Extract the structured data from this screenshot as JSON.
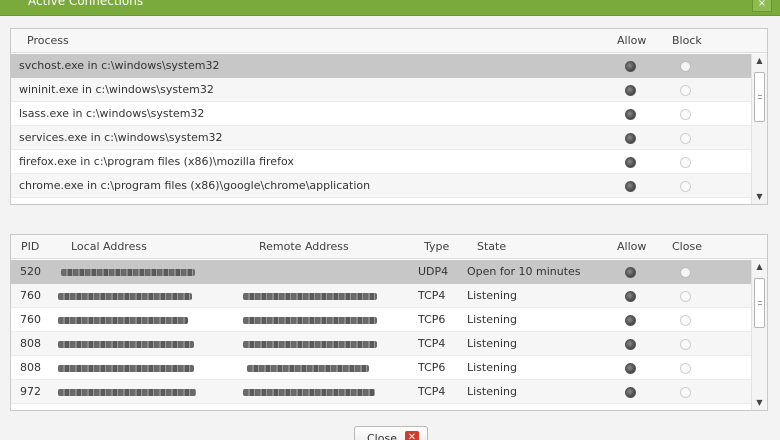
{
  "window": {
    "title": "Active Connections",
    "close_glyph": "×"
  },
  "process_table": {
    "columns": {
      "process": "Process",
      "allow": "Allow",
      "block": "Block"
    },
    "rows": [
      {
        "process": "svchost.exe in c:\\windows\\system32",
        "allow": true,
        "block": false
      },
      {
        "process": "wininit.exe in c:\\windows\\system32",
        "allow": true,
        "block": false
      },
      {
        "process": "lsass.exe in c:\\windows\\system32",
        "allow": true,
        "block": false
      },
      {
        "process": "services.exe in c:\\windows\\system32",
        "allow": true,
        "block": false
      },
      {
        "process": "firefox.exe in c:\\program files (x86)\\mozilla firefox",
        "allow": true,
        "block": false
      },
      {
        "process": "chrome.exe in c:\\program files (x86)\\google\\chrome\\application",
        "allow": true,
        "block": false
      }
    ],
    "selected_row": 0
  },
  "connection_table": {
    "columns": {
      "pid": "PID",
      "local": "Local Address",
      "remote": "Remote Address",
      "type": "Type",
      "state": "State",
      "allow": "Allow",
      "close": "Close"
    },
    "rows": [
      {
        "pid": "520",
        "type": "UDP4",
        "state": "Open for 10 minutes",
        "allow": true,
        "close": false
      },
      {
        "pid": "760",
        "type": "TCP4",
        "state": "Listening",
        "allow": true,
        "close": false
      },
      {
        "pid": "760",
        "type": "TCP6",
        "state": "Listening",
        "allow": true,
        "close": false
      },
      {
        "pid": "808",
        "type": "TCP4",
        "state": "Listening",
        "allow": true,
        "close": false
      },
      {
        "pid": "808",
        "type": "TCP6",
        "state": "Listening",
        "allow": true,
        "close": false
      },
      {
        "pid": "972",
        "type": "TCP4",
        "state": "Listening",
        "allow": true,
        "close": false
      }
    ],
    "selected_row": 0
  },
  "footer": {
    "close_label": "Close",
    "close_icon": "close-icon"
  },
  "colors": {
    "titlebar": "#7aa93c",
    "selected_row": "#c7c7c7",
    "close_icon": "#d23b2a"
  }
}
